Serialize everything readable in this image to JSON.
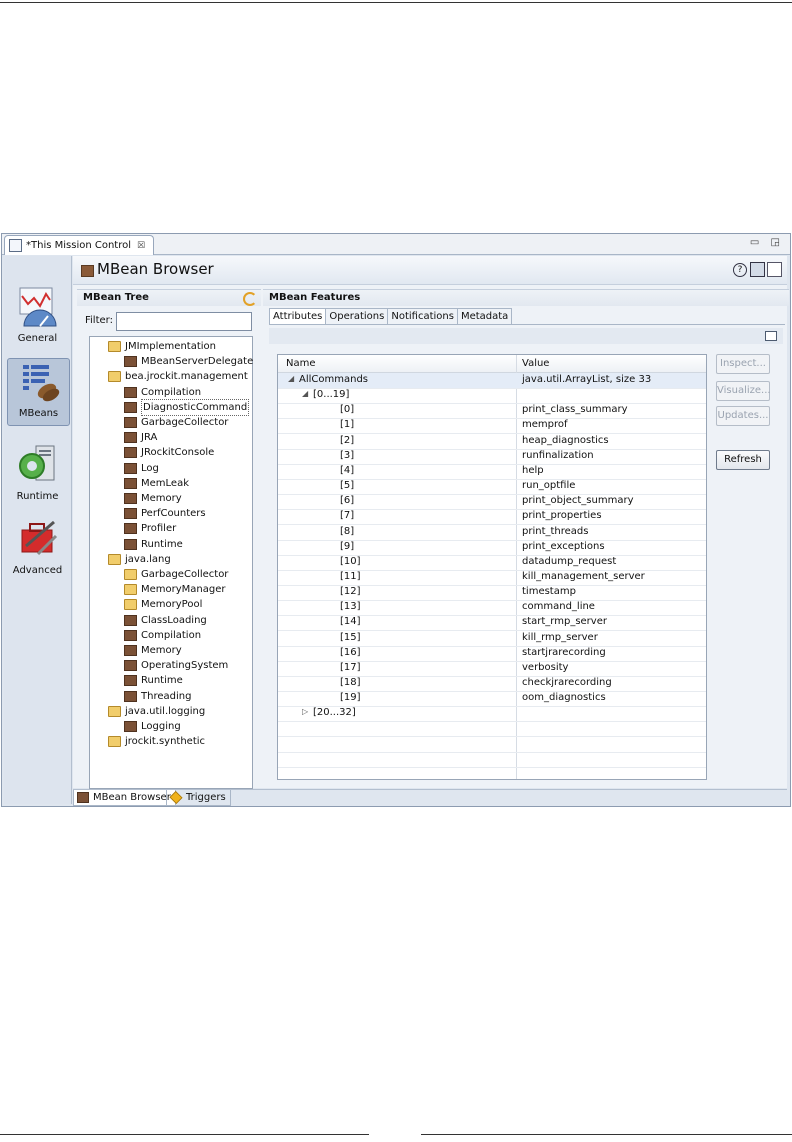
{
  "editor_tab": {
    "title": "*This Mission Control",
    "close": "☒"
  },
  "window_controls": "▭ ◲",
  "sidebar": [
    {
      "label": "General"
    },
    {
      "label": "MBeans",
      "selected": true
    },
    {
      "label": "Runtime"
    },
    {
      "label": "Advanced"
    }
  ],
  "page": {
    "title": "MBean Browser",
    "help": "?"
  },
  "tree_panel": {
    "title": "MBean Tree",
    "filter_label": "Filter:",
    "filter_value": ""
  },
  "tree": [
    {
      "label": "JMImplementation",
      "level": 0,
      "icon": "folder-icon"
    },
    {
      "label": "MBeanServerDelegate",
      "level": 1,
      "icon": "mbean-icon"
    },
    {
      "label": "bea.jrockit.management",
      "level": 0,
      "icon": "folder-icon"
    },
    {
      "label": "Compilation",
      "level": 1,
      "icon": "mbean-icon"
    },
    {
      "label": "DiagnosticCommand",
      "level": 1,
      "icon": "mbean-icon",
      "selected": true
    },
    {
      "label": "GarbageCollector",
      "level": 1,
      "icon": "mbean-icon"
    },
    {
      "label": "JRA",
      "level": 1,
      "icon": "mbean-icon"
    },
    {
      "label": "JRockitConsole",
      "level": 1,
      "icon": "mbean-icon"
    },
    {
      "label": "Log",
      "level": 1,
      "icon": "mbean-icon"
    },
    {
      "label": "MemLeak",
      "level": 1,
      "icon": "mbean-icon"
    },
    {
      "label": "Memory",
      "level": 1,
      "icon": "mbean-icon"
    },
    {
      "label": "PerfCounters",
      "level": 1,
      "icon": "mbean-icon"
    },
    {
      "label": "Profiler",
      "level": 1,
      "icon": "mbean-icon"
    },
    {
      "label": "Runtime",
      "level": 1,
      "icon": "mbean-icon"
    },
    {
      "label": "java.lang",
      "level": 0,
      "icon": "folder-icon"
    },
    {
      "label": "GarbageCollector",
      "level": 1,
      "icon": "folder-icon"
    },
    {
      "label": "MemoryManager",
      "level": 1,
      "icon": "folder-icon"
    },
    {
      "label": "MemoryPool",
      "level": 1,
      "icon": "folder-icon"
    },
    {
      "label": "ClassLoading",
      "level": 1,
      "icon": "mbean-icon"
    },
    {
      "label": "Compilation",
      "level": 1,
      "icon": "mbean-icon"
    },
    {
      "label": "Memory",
      "level": 1,
      "icon": "mbean-icon"
    },
    {
      "label": "OperatingSystem",
      "level": 1,
      "icon": "mbean-icon"
    },
    {
      "label": "Runtime",
      "level": 1,
      "icon": "mbean-icon"
    },
    {
      "label": "Threading",
      "level": 1,
      "icon": "mbean-icon"
    },
    {
      "label": "java.util.logging",
      "level": 0,
      "icon": "folder-icon"
    },
    {
      "label": "Logging",
      "level": 1,
      "icon": "mbean-icon"
    },
    {
      "label": "jrockit.synthetic",
      "level": 0,
      "icon": "folder-icon"
    }
  ],
  "features_panel": {
    "title": "MBean Features",
    "tabs": [
      "Attributes",
      "Operations",
      "Notifications",
      "Metadata"
    ],
    "active_tab": "Attributes"
  },
  "attributes_table": {
    "columns": [
      "Name",
      "Value"
    ],
    "rows": [
      {
        "name": "AllCommands",
        "value": "java.util.ArrayList, size 33",
        "level": 0,
        "expander": "expanded"
      },
      {
        "name": "[0...19]",
        "value": "",
        "level": 1,
        "expander": "expanded"
      },
      {
        "name": "[0]",
        "value": "print_class_summary",
        "level": 2
      },
      {
        "name": "[1]",
        "value": "memprof",
        "level": 2
      },
      {
        "name": "[2]",
        "value": "heap_diagnostics",
        "level": 2
      },
      {
        "name": "[3]",
        "value": "runfinalization",
        "level": 2
      },
      {
        "name": "[4]",
        "value": "help",
        "level": 2
      },
      {
        "name": "[5]",
        "value": "run_optfile",
        "level": 2
      },
      {
        "name": "[6]",
        "value": "print_object_summary",
        "level": 2
      },
      {
        "name": "[7]",
        "value": "print_properties",
        "level": 2
      },
      {
        "name": "[8]",
        "value": "print_threads",
        "level": 2
      },
      {
        "name": "[9]",
        "value": "print_exceptions",
        "level": 2
      },
      {
        "name": "[10]",
        "value": "datadump_request",
        "level": 2
      },
      {
        "name": "[11]",
        "value": "kill_management_server",
        "level": 2
      },
      {
        "name": "[12]",
        "value": "timestamp",
        "level": 2
      },
      {
        "name": "[13]",
        "value": "command_line",
        "level": 2
      },
      {
        "name": "[14]",
        "value": "start_rmp_server",
        "level": 2
      },
      {
        "name": "[15]",
        "value": "kill_rmp_server",
        "level": 2
      },
      {
        "name": "[16]",
        "value": "startjrarecording",
        "level": 2
      },
      {
        "name": "[17]",
        "value": "verbosity",
        "level": 2
      },
      {
        "name": "[18]",
        "value": "checkjrarecording",
        "level": 2
      },
      {
        "name": "[19]",
        "value": "oom_diagnostics",
        "level": 2
      },
      {
        "name": "[20...32]",
        "value": "",
        "level": 1,
        "expander": "collapsed"
      }
    ]
  },
  "buttons": [
    {
      "label": "Inspect...",
      "enabled": false
    },
    {
      "label": "Visualize...",
      "enabled": false
    },
    {
      "label": "Updates...",
      "enabled": false
    },
    {
      "label": "Refresh",
      "enabled": true
    }
  ],
  "bottom_tabs": [
    {
      "label": "MBean Browser",
      "active": true,
      "icon": "mbean-icon"
    },
    {
      "label": "Triggers",
      "active": false,
      "icon": "trigger-icon"
    }
  ]
}
